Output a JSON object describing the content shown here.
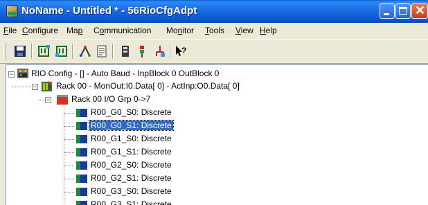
{
  "window": {
    "title": "NoName - Untitled * - 56RioCfgAdpt"
  },
  "menu": [
    {
      "label": "File",
      "acc": "F",
      "rest": "ile"
    },
    {
      "label": "Configure",
      "acc": "C",
      "rest": "onfigure"
    },
    {
      "label": "Map",
      "pre": "Ma",
      "acc": "p",
      "rest": ""
    },
    {
      "label": "Communication",
      "pre": "C",
      "acc": "o",
      "rest": "mmunication"
    },
    {
      "label": "Monitor",
      "pre": "Mo",
      "acc": "n",
      "rest": "itor"
    },
    {
      "label": "Tools",
      "acc": "T",
      "rest": "ools"
    },
    {
      "label": "View",
      "acc": "V",
      "rest": "iew"
    },
    {
      "label": "Help",
      "acc": "H",
      "rest": "elp"
    }
  ],
  "toolbar": {
    "buttons": [
      "save-icon",
      "download-icon",
      "upload-icon",
      "network-icon",
      "properties-icon",
      "io-module-icon",
      "status-icon",
      "connection-icon",
      "context-help-icon"
    ]
  },
  "tree": {
    "root": "RIO Config - [] - Auto Baud - InpBlock 0 OutBlock 0",
    "rack": "Rack 00 - MonOut:I0.Data[  0] - ActInp:O0.Data[  0]",
    "group": "Rack 00 I/O Grp 0->7",
    "slots": [
      "R00_G0_S0: Discrete",
      "R00_G0_S1: Discrete",
      "R00_G1_S0: Discrete",
      "R00_G1_S1: Discrete",
      "R00_G2_S0: Discrete",
      "R00_G2_S1: Discrete",
      "R00_G3_S0: Discrete",
      "R00_G3_S1: Discrete"
    ],
    "selected_index": 1
  },
  "colors": {
    "selection": "#316ac5",
    "titlebar": "#0a57d2",
    "slot_icon_blue": "#1a3a9a",
    "slot_icon_green": "#1a8a3a"
  }
}
